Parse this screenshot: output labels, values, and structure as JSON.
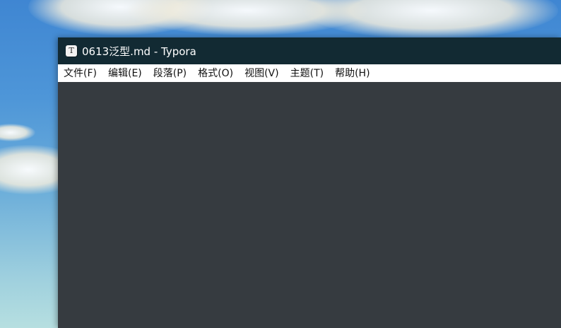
{
  "window": {
    "title": "0613泛型.md - Typora",
    "app_icon_glyph": "T"
  },
  "menu": {
    "items": [
      {
        "label": "文件(F)"
      },
      {
        "label": "编辑(E)"
      },
      {
        "label": "段落(P)"
      },
      {
        "label": "格式(O)"
      },
      {
        "label": "视图(V)"
      },
      {
        "label": "主题(T)"
      },
      {
        "label": "帮助(H)"
      }
    ]
  },
  "colors": {
    "titlebar": "#122a33",
    "menubar": "#ffffff",
    "editor_background": "#363b40"
  }
}
